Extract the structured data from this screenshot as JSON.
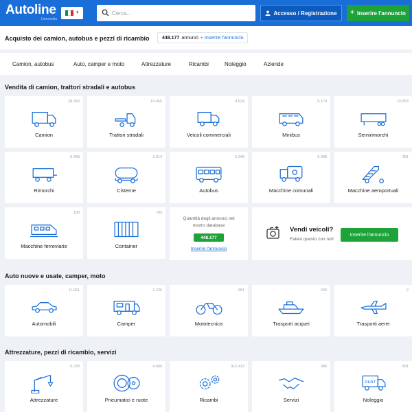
{
  "header": {
    "logo": "Autoline",
    "logo_sub": "Linemedia",
    "flag_colors": [
      "#009246",
      "#ffffff",
      "#ce2b37"
    ],
    "search_placeholder": "Cerca...",
    "login_label": "Accesso / Registrazione",
    "add_label": "Inserire l'annuncio"
  },
  "title_row": {
    "title": "Acquisto dei camion, autobus e pezzi di ricambio",
    "count": "448.177",
    "count_unit": "annunci",
    "link": "+ Inserire l'annuncio"
  },
  "tabs": [
    "Camion, autobus",
    "Auto, camper e moto",
    "Attrezzature",
    "Ricambi",
    "Noleggio",
    "Aziende"
  ],
  "sections": [
    {
      "title": "Vendita di camion, trattori stradali e autobus",
      "items": [
        {
          "label": "Camion",
          "count": "28.959",
          "icon": "truck-icon"
        },
        {
          "label": "Trattori stradali",
          "count": "19.465",
          "icon": "tractor-unit-icon"
        },
        {
          "label": "Veicoli commerciali",
          "count": "4.624",
          "icon": "van-truck-icon"
        },
        {
          "label": "Minibus",
          "count": "9.174",
          "icon": "minibus-icon"
        },
        {
          "label": "Semirimorchi",
          "count": "15.563",
          "icon": "semitrailer-icon"
        },
        {
          "label": "Rimorchi",
          "count": "6.468",
          "icon": "trailer-icon"
        },
        {
          "label": "Cisterne",
          "count": "3.314",
          "icon": "tanker-icon"
        },
        {
          "label": "Autobus",
          "count": "6.246",
          "icon": "bus-icon"
        },
        {
          "label": "Macchine comunali",
          "count": "6.398",
          "icon": "municipal-vehicle-icon"
        },
        {
          "label": "Macchine aeroportuali",
          "count": "351",
          "icon": "airport-stairs-icon"
        },
        {
          "label": "Macchine ferroviarie",
          "count": "109",
          "icon": "train-icon"
        },
        {
          "label": "Container",
          "count": "783",
          "icon": "container-icon"
        }
      ]
    },
    {
      "title": "Auto nuove e usate, camper, moto",
      "items": [
        {
          "label": "Automobili",
          "count": "11.091",
          "icon": "car-icon"
        },
        {
          "label": "Camper",
          "count": "1.236",
          "icon": "camper-icon"
        },
        {
          "label": "Mototecnica",
          "count": "681",
          "icon": "motorcycle-icon"
        },
        {
          "label": "Trasporti acquei",
          "count": "203",
          "icon": "boat-icon"
        },
        {
          "label": "Trasporti aerei",
          "count": "2",
          "icon": "plane-icon"
        }
      ]
    },
    {
      "title": "Attrezzature, pezzi di ricambio, servizi",
      "items": [
        {
          "label": "Attrezzature",
          "count": "5.078",
          "icon": "crane-icon"
        },
        {
          "label": "Pneumatici e ruote",
          "count": "4.999",
          "icon": "tire-icon"
        },
        {
          "label": "Ricambi",
          "count": "312.413",
          "icon": "gears-icon"
        },
        {
          "label": "Servizi",
          "count": "386",
          "icon": "handshake-icon"
        },
        {
          "label": "Noleggio",
          "count": "891",
          "icon": "rent-truck-icon"
        }
      ]
    }
  ],
  "db_card": {
    "text": "Quantità degli annunci nel nostro database",
    "count": "448.177",
    "link": "Inserire l'annuncio"
  },
  "sell_card": {
    "title": "Vendi veicoli?",
    "subtitle": "Fatelo questo con noi!",
    "button": "Inserire l'annuncio"
  },
  "rent_badge": "RENT"
}
